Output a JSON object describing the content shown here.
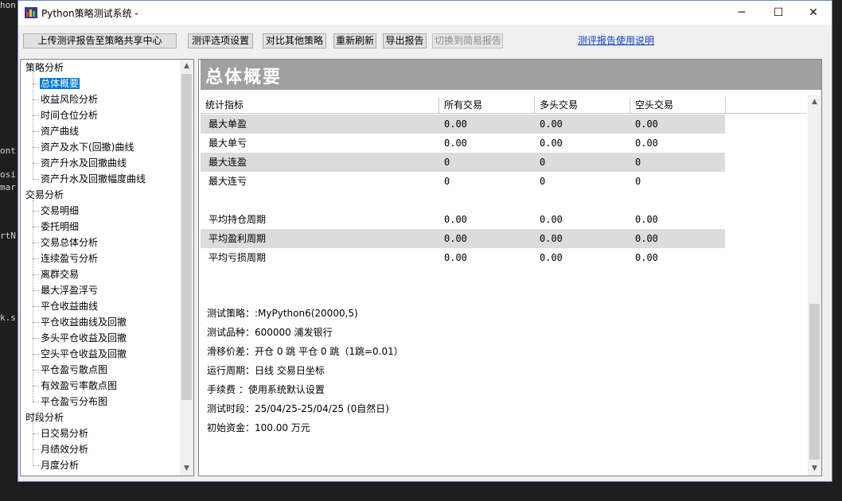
{
  "background_editor": [
    "hon",
    "ont",
    "osi",
    "mar",
    "rtN",
    "k.s"
  ],
  "window": {
    "title": "Python策略测试系统 -",
    "minimize": "─",
    "maximize": "☐",
    "close": "✕"
  },
  "toolbar": {
    "upload": "上传测评报告至策略共享中心",
    "options": "测评选项设置",
    "compare": "对比其他策略",
    "refresh": "重新刷新",
    "export": "导出报告",
    "switch_simple": "切换到简易报告",
    "help_link": "测评报告使用说明"
  },
  "tree": {
    "groups": [
      {
        "label": "策略分析",
        "items": [
          "总体概要",
          "收益风险分析",
          "时间仓位分析",
          "资产曲线",
          "资产及水下(回撤)曲线",
          "资产升水及回撤曲线",
          "资产升水及回撤幅度曲线"
        ]
      },
      {
        "label": "交易分析",
        "items": [
          "交易明细",
          "委托明细",
          "交易总体分析",
          "连续盈亏分析",
          "离群交易",
          "最大浮盈浮亏",
          "平仓收益曲线",
          "平仓收益曲线及回撤",
          "多头平仓收益及回撤",
          "空头平仓收益及回撤",
          "平仓盈亏散点图",
          "有效盈亏率散点图",
          "平仓盈亏分布图"
        ]
      },
      {
        "label": "时段分析",
        "items": [
          "日交易分析",
          "月绩效分析",
          "月度分析"
        ]
      }
    ],
    "selected": "总体概要"
  },
  "main": {
    "title": "总体概要",
    "columns": [
      "统计指标",
      "所有交易",
      "多头交易",
      "空头交易"
    ],
    "rows": [
      {
        "name": "最大单盈",
        "all": "0.00",
        "long": "0.00",
        "short": "0.00"
      },
      {
        "name": "最大单亏",
        "all": "0.00",
        "long": "0.00",
        "short": "0.00"
      },
      {
        "name": "最大连盈",
        "all": "0",
        "long": "0",
        "short": "0"
      },
      {
        "name": "最大连亏",
        "all": "0",
        "long": "0",
        "short": "0"
      },
      {
        "name": "",
        "all": "",
        "long": "",
        "short": ""
      },
      {
        "name": "平均持仓周期",
        "all": "0.00",
        "long": "0.00",
        "short": "0.00"
      },
      {
        "name": "平均盈利周期",
        "all": "0.00",
        "long": "0.00",
        "short": "0.00"
      },
      {
        "name": "平均亏损周期",
        "all": "0.00",
        "long": "0.00",
        "short": "0.00"
      }
    ],
    "info": [
      "测试策略：:MyPython6(20000,5)",
      "测试品种：600000 浦发银行",
      "滑移价差：开仓 0 跳 平仓 0 跳（1跳=0.01）",
      "运行周期：日线 交易日坐标",
      "手续费  ：使用系统默认设置",
      "测试时段：25/04/25-25/04/25 (0自然日)",
      "初始资金：100.00 万元"
    ]
  },
  "colors": {
    "accent_selected": "#0078d7",
    "header_gray": "#a0a0a0",
    "row_alt": "#dcdcdc",
    "link": "#0a3fc4"
  }
}
